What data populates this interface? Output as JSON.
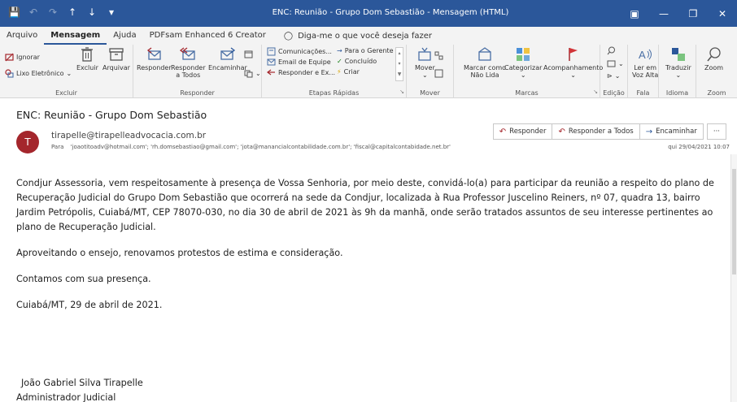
{
  "window": {
    "title": "ENC: Reunião - Grupo Dom Sebastião  -  Mensagem (HTML)",
    "qat": [
      "save-icon",
      "undo-icon",
      "redo-icon",
      "up-icon",
      "down-icon",
      "customize-icon"
    ],
    "controls": [
      "restore-ribbon-icon",
      "minimize-icon",
      "maximize-icon",
      "close-icon"
    ]
  },
  "tabs": {
    "arquivo": "Arquivo",
    "mensagem": "Mensagem",
    "ajuda": "Ajuda",
    "pdfsam": "PDFsam Enhanced 6 Creator",
    "tell_me": "Diga-me o que você deseja fazer"
  },
  "ribbon": {
    "excluir": {
      "ignorar": "Ignorar",
      "lixo": "Lixo Eletrônico",
      "excluir": "Excluir",
      "arquivar": "Arquivar",
      "label": "Excluir"
    },
    "responder": {
      "responder": "Responder",
      "responder_todos_1": "Responder",
      "responder_todos_2": "a Todos",
      "encaminhar": "Encaminhar",
      "label": "Responder"
    },
    "etapas": {
      "comunicacoes": "Comunicações...",
      "email_equipe": "Email de Equipe",
      "responder_ex": "Responder e Ex...",
      "para_gerente": "Para o Gerente",
      "concluido": "Concluído",
      "criar": "Criar",
      "label": "Etapas Rápidas"
    },
    "mover": {
      "mover": "Mover",
      "label": "Mover"
    },
    "marcas": {
      "marcar_1": "Marcar como",
      "marcar_2": "Não Lida",
      "categorizar": "Categorizar",
      "acompanhamento": "Acompanhamento",
      "label": "Marcas"
    },
    "edicao": {
      "label": "Edição"
    },
    "fala": {
      "ler_1": "Ler em",
      "ler_2": "Voz Alta",
      "label": "Fala"
    },
    "idioma": {
      "traduzir": "Traduzir",
      "label": "Idioma"
    },
    "zoom": {
      "zoom": "Zoom",
      "label": "Zoom"
    }
  },
  "mail": {
    "subject": "ENC: Reunião - Grupo Dom Sebastião",
    "avatar_initial": "T",
    "sender": "tirapelle@tirapelleadvocacia.com.br",
    "to_label": "Para",
    "recipients": "'joaotitoadv@hotmail.com'; 'rh.domsebastiao@gmail.com'; 'jota@manancialcontabilidade.com.br'; 'fiscal@capitalcontabidade.net.br'",
    "date": "qui 29/04/2021 10:07",
    "actions": {
      "reply": "Responder",
      "reply_all": "Responder a Todos",
      "forward": "Encaminhar",
      "more": "···"
    }
  },
  "body": {
    "p1": "Condjur Assessoria, vem respeitosamente à presença de Vossa Senhoria, por meio deste, convidá-lo(a) para participar da reunião a respeito do plano de Recuperação Judicial do Grupo Dom Sebastião que ocorrerá na sede da Condjur, localizada à Rua Professor Juscelino Reiners, nº 07, quadra 13, bairro Jardim Petrópolis, Cuiabá/MT, CEP 78070-030, no dia 30 de abril de 2021 às 9h da manhã, onde serão tratados assuntos de seu interesse pertinentes ao plano de Recuperação Judicial.",
    "p2": "Aproveitando o ensejo, renovamos protestos de estima e consideração.",
    "p3": "Contamos com sua presença.",
    "p4": "Cuiabá/MT, 29 de abril de 2021.",
    "sig_name": "João Gabriel Silva Tirapelle",
    "sig_title": "Administrador Judicial"
  },
  "colors": {
    "titlebar": "#2b579a",
    "avatar": "#a4262c",
    "ribbon": "#f3f3f3"
  }
}
